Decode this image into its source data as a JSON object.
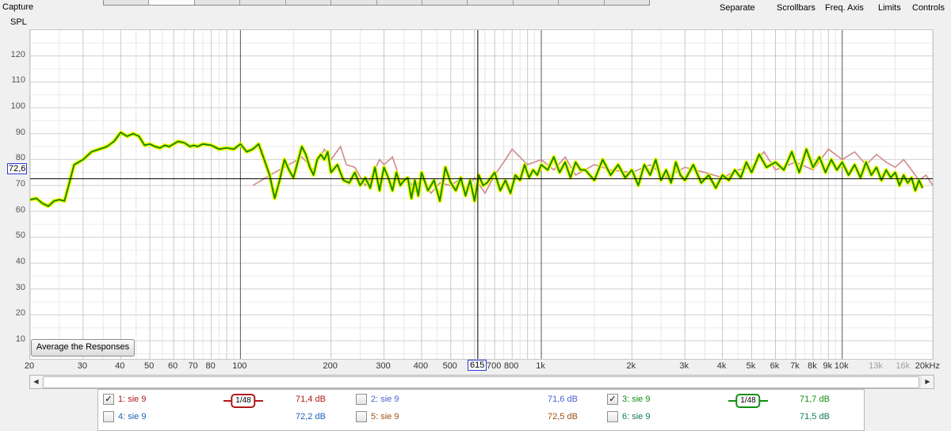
{
  "window": {
    "capture_label": "Capture",
    "top_buttons": [
      "Separate",
      "Scrollbars",
      "Freq. Axis",
      "Limits",
      "Controls"
    ]
  },
  "plot": {
    "avg_button": "Average the Responses",
    "cursor_freq": "615",
    "cursor_spl": "72,6"
  },
  "legend": [
    {
      "name": "1: sie 9",
      "checked": true,
      "color": "#b01818",
      "smoothing": "1/48",
      "level": "71,4 dB"
    },
    {
      "name": "2: sie 9",
      "checked": false,
      "color": "#4a5fd0",
      "smoothing": "",
      "level": "71,6 dB"
    },
    {
      "name": "3: sie 9",
      "checked": true,
      "color": "#109010",
      "smoothing": "1/48",
      "level": "71,7 dB"
    },
    {
      "name": "4: sie 9",
      "checked": false,
      "color": "#1a63b5",
      "smoothing": "",
      "level": "72,2 dB"
    },
    {
      "name": "5: sie 9",
      "checked": false,
      "color": "#a05010",
      "smoothing": "",
      "level": "72,5 dB"
    },
    {
      "name": "6: sie 9",
      "checked": false,
      "color": "#0f7a55",
      "smoothing": "",
      "level": "71,5 dB"
    }
  ],
  "chart_data": {
    "type": "line",
    "ylabel": "SPL",
    "ylim": [
      3,
      130
    ],
    "yticks": [
      10,
      20,
      30,
      40,
      50,
      60,
      70,
      80,
      90,
      100,
      110,
      120
    ],
    "xlim": [
      20,
      20000
    ],
    "xscale": "log",
    "xticks": [
      {
        "value": 20,
        "label": "20",
        "faded": false
      },
      {
        "value": 30,
        "label": "30",
        "faded": false
      },
      {
        "value": 40,
        "label": "40",
        "faded": false
      },
      {
        "value": 50,
        "label": "50",
        "faded": false
      },
      {
        "value": 60,
        "label": "60",
        "faded": false
      },
      {
        "value": 70,
        "label": "70",
        "faded": false
      },
      {
        "value": 80,
        "label": "80",
        "faded": false
      },
      {
        "value": 100,
        "label": "100",
        "faded": false
      },
      {
        "value": 200,
        "label": "200",
        "faded": false
      },
      {
        "value": 300,
        "label": "300",
        "faded": false
      },
      {
        "value": 400,
        "label": "400",
        "faded": false
      },
      {
        "value": 500,
        "label": "500",
        "faded": false
      },
      {
        "value": 700,
        "label": "700",
        "faded": false
      },
      {
        "value": 800,
        "label": "800",
        "faded": false
      },
      {
        "value": 1000,
        "label": "1k",
        "faded": false
      },
      {
        "value": 2000,
        "label": "2k",
        "faded": false
      },
      {
        "value": 3000,
        "label": "3k",
        "faded": false
      },
      {
        "value": 4000,
        "label": "4k",
        "faded": false
      },
      {
        "value": 5000,
        "label": "5k",
        "faded": false
      },
      {
        "value": 6000,
        "label": "6k",
        "faded": false
      },
      {
        "value": 7000,
        "label": "7k",
        "faded": false
      },
      {
        "value": 8000,
        "label": "8k",
        "faded": false
      },
      {
        "value": 9000,
        "label": "9k",
        "faded": false
      },
      {
        "value": 10000,
        "label": "10k",
        "faded": false
      },
      {
        "value": 13000,
        "label": "13k",
        "faded": true
      },
      {
        "value": 16000,
        "label": "16k",
        "faded": true
      },
      {
        "value": 20000,
        "label": "20kHz",
        "faded": false
      }
    ],
    "cursor": {
      "freq": 615,
      "spl": 72.6
    },
    "series": [
      {
        "color": "#d08a8a",
        "x": [
          110,
          130,
          150,
          160,
          175,
          190,
          200,
          215,
          225,
          240,
          260,
          275,
          290,
          300,
          320,
          340,
          360,
          380,
          400,
          430,
          460,
          500,
          530,
          560,
          600,
          650,
          700,
          750,
          800,
          900,
          1000,
          1100,
          1200,
          1300,
          1500,
          1700,
          2000,
          2300,
          2600,
          3000,
          3500,
          4000,
          4500,
          5000,
          5500,
          6000,
          7000,
          8000,
          9000,
          10000,
          11000,
          12000,
          13000,
          14000,
          15000,
          16000,
          17000,
          18000,
          19000,
          20000
        ],
        "y": [
          70,
          75,
          79,
          81,
          76,
          84,
          80,
          85,
          78,
          77,
          70,
          74,
          80,
          78,
          81,
          72,
          73,
          68,
          74,
          67,
          71,
          70,
          72,
          68,
          73,
          67,
          74,
          79,
          84,
          78,
          80,
          76,
          81,
          74,
          78,
          76,
          75,
          78,
          73,
          77,
          75,
          73,
          76,
          77,
          83,
          76,
          79,
          76,
          84,
          80,
          83,
          78,
          82,
          79,
          77,
          80,
          76,
          72,
          74,
          70
        ]
      }
    ],
    "main_series": {
      "color": "#1a8a00",
      "halo": "#f2ff00",
      "x": [
        20,
        21,
        22,
        23,
        24,
        25,
        26,
        27,
        28,
        30,
        32,
        34,
        36,
        38,
        40,
        42,
        44,
        46,
        48,
        50,
        52,
        54,
        56,
        58,
        60,
        62,
        65,
        68,
        70,
        72,
        75,
        80,
        85,
        90,
        95,
        100,
        105,
        110,
        115,
        120,
        125,
        130,
        135,
        140,
        145,
        150,
        155,
        160,
        165,
        170,
        175,
        180,
        185,
        190,
        195,
        200,
        210,
        220,
        230,
        240,
        250,
        260,
        270,
        280,
        290,
        300,
        310,
        320,
        330,
        340,
        350,
        360,
        370,
        380,
        390,
        400,
        420,
        440,
        460,
        480,
        500,
        520,
        540,
        560,
        580,
        600,
        620,
        640,
        660,
        680,
        700,
        730,
        760,
        790,
        820,
        850,
        880,
        910,
        940,
        970,
        1000,
        1050,
        1100,
        1150,
        1200,
        1250,
        1300,
        1350,
        1400,
        1500,
        1600,
        1700,
        1800,
        1900,
        2000,
        2100,
        2200,
        2300,
        2400,
        2500,
        2600,
        2700,
        2800,
        2900,
        3000,
        3200,
        3400,
        3600,
        3800,
        4000,
        4200,
        4400,
        4600,
        4800,
        5000,
        5300,
        5600,
        6000,
        6400,
        6800,
        7200,
        7600,
        8000,
        8400,
        8800,
        9200,
        9600,
        10000,
        10500,
        11000,
        11500,
        12000,
        12500,
        13000,
        13500,
        14000,
        14500,
        15000,
        15500,
        16000,
        16500,
        17000,
        17500,
        18000,
        18500,
        19000,
        19500,
        20000
      ],
      "y": [
        64.5,
        65,
        63,
        62,
        64,
        64.5,
        64,
        71,
        78,
        80,
        83,
        84,
        85,
        87,
        90.5,
        89,
        90,
        89,
        85.5,
        86,
        85,
        84.5,
        85.5,
        85,
        86,
        87,
        86.5,
        85,
        85.5,
        85,
        86,
        85.5,
        84,
        84.5,
        84,
        86,
        83,
        84,
        86,
        80,
        74,
        65,
        72,
        80,
        76,
        73,
        79,
        85,
        82,
        77,
        74,
        80,
        82,
        80,
        83,
        75,
        78,
        72,
        71,
        75,
        70,
        73,
        69,
        77,
        68,
        77,
        73,
        68,
        75,
        70,
        72,
        73,
        65,
        72,
        66,
        75,
        68,
        72,
        64,
        77,
        71,
        68,
        73,
        66,
        72,
        64,
        74,
        70,
        71,
        73,
        75,
        68,
        72,
        67,
        74,
        72,
        78,
        73,
        76,
        74,
        78,
        76,
        81,
        75,
        79,
        73,
        79,
        76,
        76,
        72,
        80,
        74,
        78,
        73,
        76,
        70,
        78,
        74,
        80,
        72,
        76,
        71,
        79,
        74,
        72,
        78,
        71,
        74,
        69,
        74,
        72,
        76,
        73,
        79,
        75,
        82,
        77,
        79,
        76,
        83,
        75,
        84,
        77,
        81,
        75,
        80,
        76,
        79,
        74,
        78,
        73,
        79,
        74,
        77,
        72,
        76,
        73,
        75,
        70,
        74,
        71,
        73,
        68,
        72,
        69
      ]
    }
  }
}
